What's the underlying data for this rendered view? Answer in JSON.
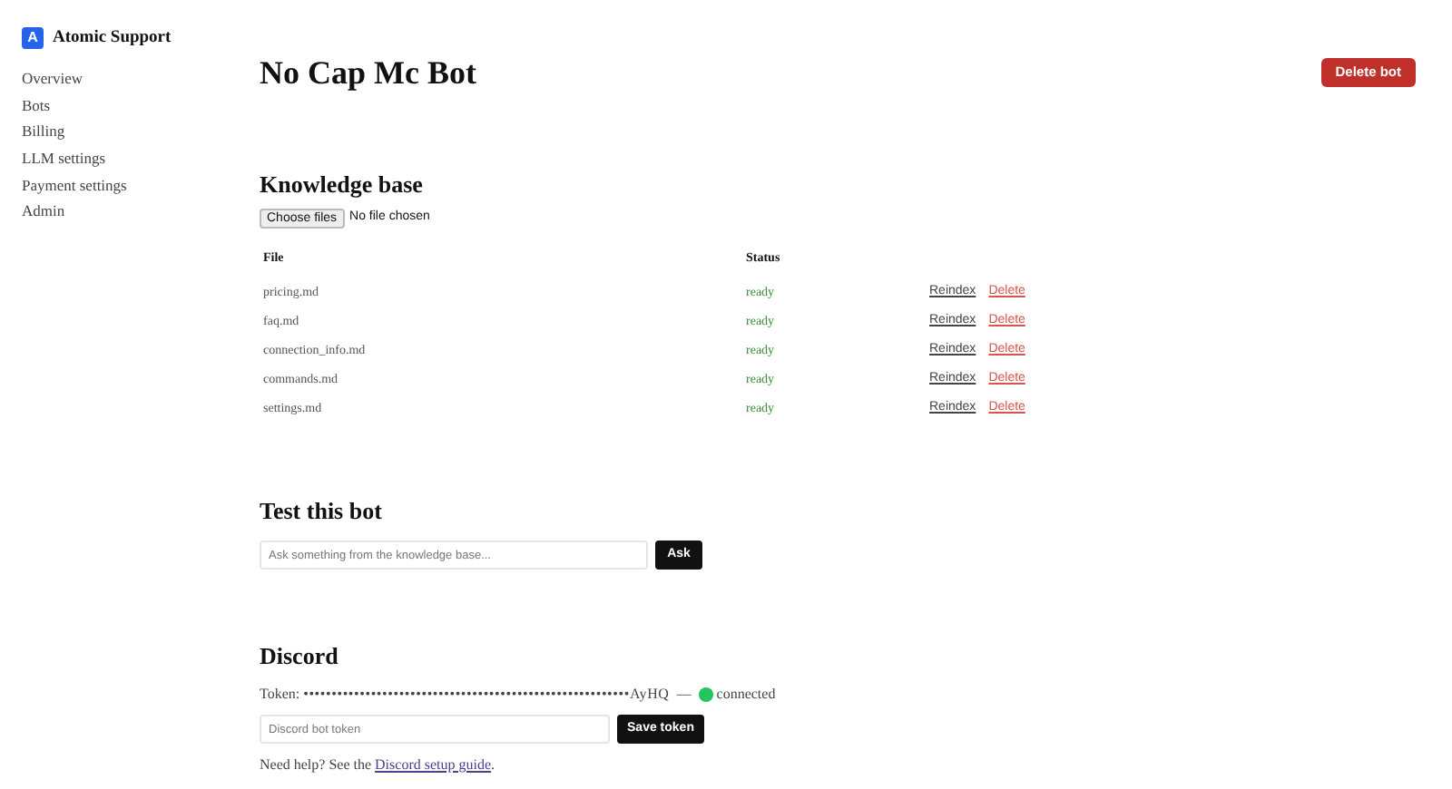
{
  "sidebar": {
    "brand": "Atomic Support",
    "logo_letter": "A",
    "items": [
      "Overview",
      "Bots",
      "Billing",
      "LLM settings",
      "Payment settings",
      "Admin"
    ]
  },
  "page": {
    "title": "No Cap Mc Bot",
    "delete_button": "Delete bot"
  },
  "knowledge_base": {
    "title": "Knowledge base",
    "file_button": "Choose files",
    "file_status": "No file chosen",
    "columns": [
      "File",
      "Status"
    ],
    "rows": [
      {
        "file": "pricing.md",
        "status": "ready",
        "reindex": "Reindex",
        "delete": "Delete"
      },
      {
        "file": "faq.md",
        "status": "ready",
        "reindex": "Reindex",
        "delete": "Delete"
      },
      {
        "file": "connection_info.md",
        "status": "ready",
        "reindex": "Reindex",
        "delete": "Delete"
      },
      {
        "file": "commands.md",
        "status": "ready",
        "reindex": "Reindex",
        "delete": "Delete"
      },
      {
        "file": "settings.md",
        "status": "ready",
        "reindex": "Reindex",
        "delete": "Delete"
      }
    ]
  },
  "test": {
    "title": "Test this bot",
    "placeholder": "Ask something from the knowledge base...",
    "button": "Ask"
  },
  "discord": {
    "title": "Discord",
    "token_label": "Token:",
    "token": "••••••••••••••••••••••••••••••••••••••••••••••••••••••••••AyHQ",
    "separator": "—",
    "status": "connected",
    "online": true,
    "placeholder": "Discord bot token",
    "button": "Save token",
    "help_text": "Need help? See the",
    "help_link": "Discord setup guide",
    "help_end": "."
  }
}
